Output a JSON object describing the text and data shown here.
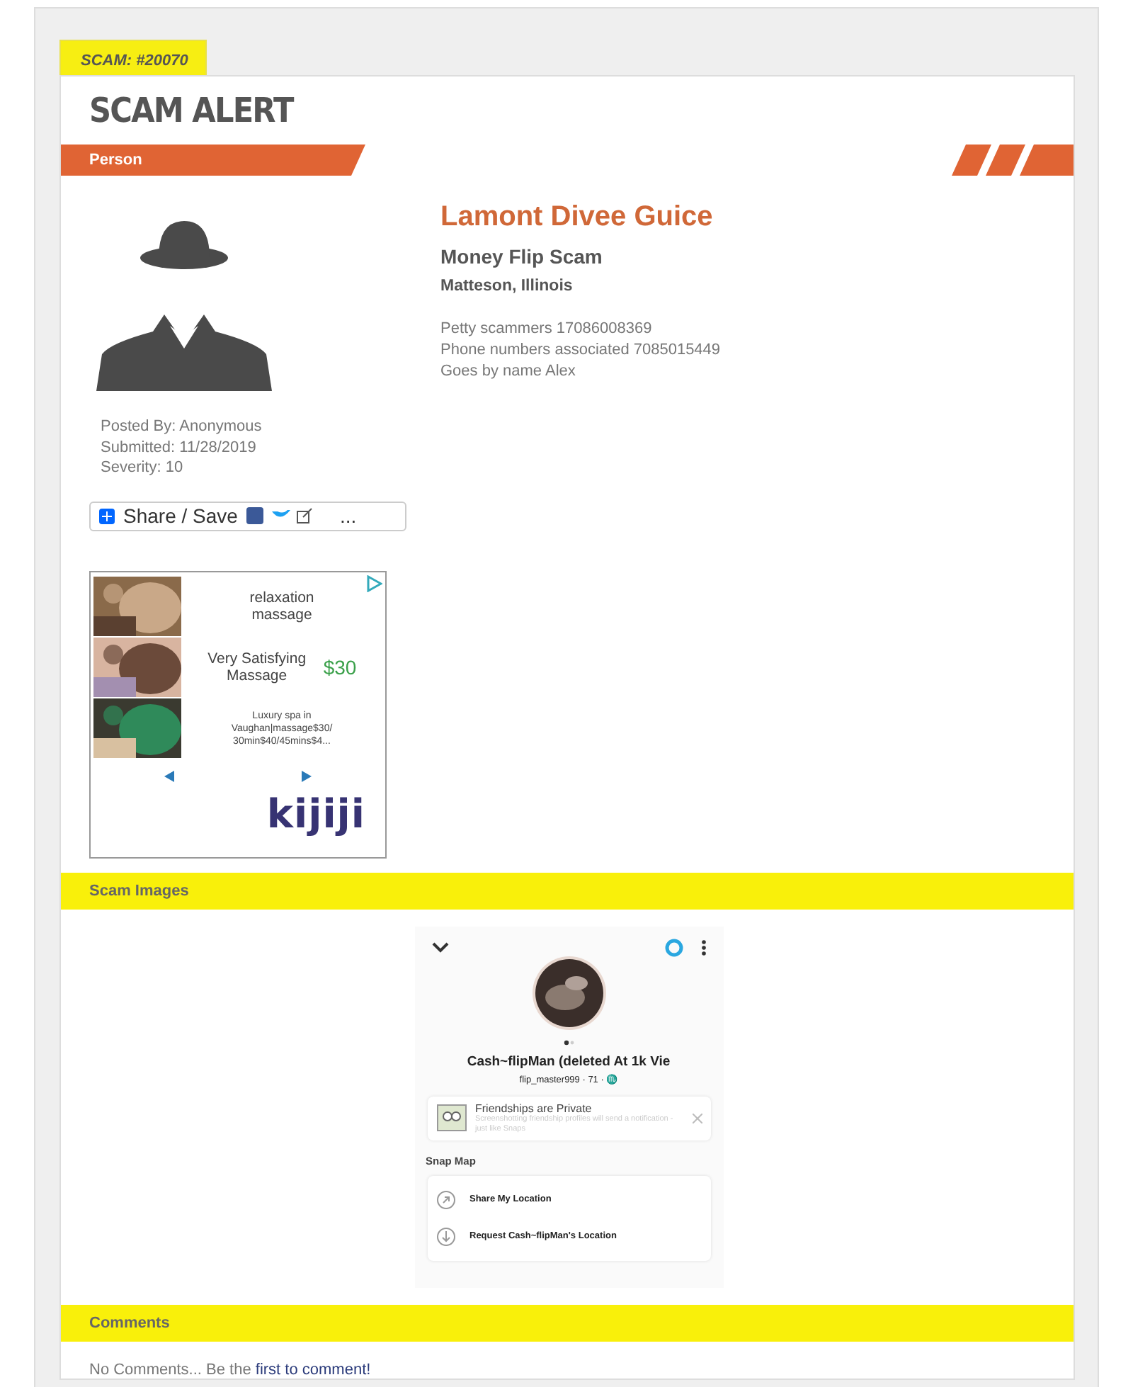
{
  "tag": "SCAM: #20070",
  "header": {
    "title": "SCAM ALERT"
  },
  "person_section": {
    "title": "Person"
  },
  "person": {
    "name": "Lamont Divee Guice",
    "scam_type": "Money Flip Scam",
    "location": "Matteson, Illinois",
    "details": [
      "Petty scammers 17086008369",
      "Phone numbers associated 7085015449",
      "Goes by name Alex"
    ]
  },
  "meta": [
    "Posted By: Anonymous",
    "Submitted: 11/28/2019",
    "Severity: 10"
  ],
  "share": {
    "label": "Share / Save",
    "more": "..."
  },
  "ad": {
    "items": [
      {
        "kind": "picture",
        "title": "relaxation massage"
      },
      {
        "kind": "picture",
        "title": "Very Satisfying Massage",
        "price": "$30"
      },
      {
        "kind": "picture",
        "description": "Luxury spa in Vaughan|massage$30/ 30min$40/45mins$4..."
      }
    ],
    "brand": "kijiji"
  },
  "images_section": {
    "title": "Scam Images"
  },
  "scam_image": {
    "display_name": "Cash~flipMan (deleted At 1k Vie",
    "username_line": "flip_master999 · 71 · ♏",
    "notice_title": "Friendships are Private",
    "notice_text": "Screenshotting friendship profiles will send a notification - just like Snaps",
    "map_title": "Snap Map",
    "actions": [
      "Share My Location",
      "Request Cash~flipMan's Location"
    ]
  },
  "comments_section": {
    "title": "Comments"
  },
  "comments": {
    "empty_text": "No Comments... Be the",
    "link": "first to comment!"
  }
}
